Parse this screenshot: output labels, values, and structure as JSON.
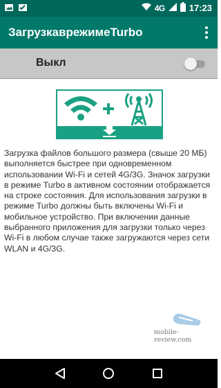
{
  "status_bar": {
    "network": "4G",
    "time": "17:23",
    "icons": [
      "gallery-icon",
      "image-icon",
      "wifi-icon",
      "signal-icon",
      "battery-icon"
    ]
  },
  "app_bar": {
    "title": "ЗагрузкаврежимеTurbo"
  },
  "turbo_switch": {
    "label": "Выкл",
    "state": "off"
  },
  "illustration": {
    "icons": [
      "wifi-icon",
      "plus-icon",
      "cell-tower-icon",
      "download-arrow-icon"
    ],
    "accent": "#1aa183"
  },
  "description": {
    "text": "Загрузка файлов большого размера (свыше 20 МБ) выполняется быстрее при одновременном использовании Wi-Fi и сетей 4G/3G. Значок загрузки в режиме Turbo в активном состоянии отображается на строке состояния. Для использования загрузки в режиме Turbo должны быть включены Wi-Fi и мобильное устройство. При включении данные выбранного приложения для загрузки только через Wi-Fi в любом случае также загружаются через сети WLAN и 4G/3G."
  },
  "watermark": {
    "text": "mobile-review.com"
  },
  "nav_bar": {
    "icons": [
      "back-icon",
      "home-icon",
      "recents-icon"
    ]
  },
  "colors": {
    "status_bar": "#00675b",
    "app_bar": "#00796b",
    "switch_bar": "#c7c7c7",
    "accent": "#1aa183"
  }
}
